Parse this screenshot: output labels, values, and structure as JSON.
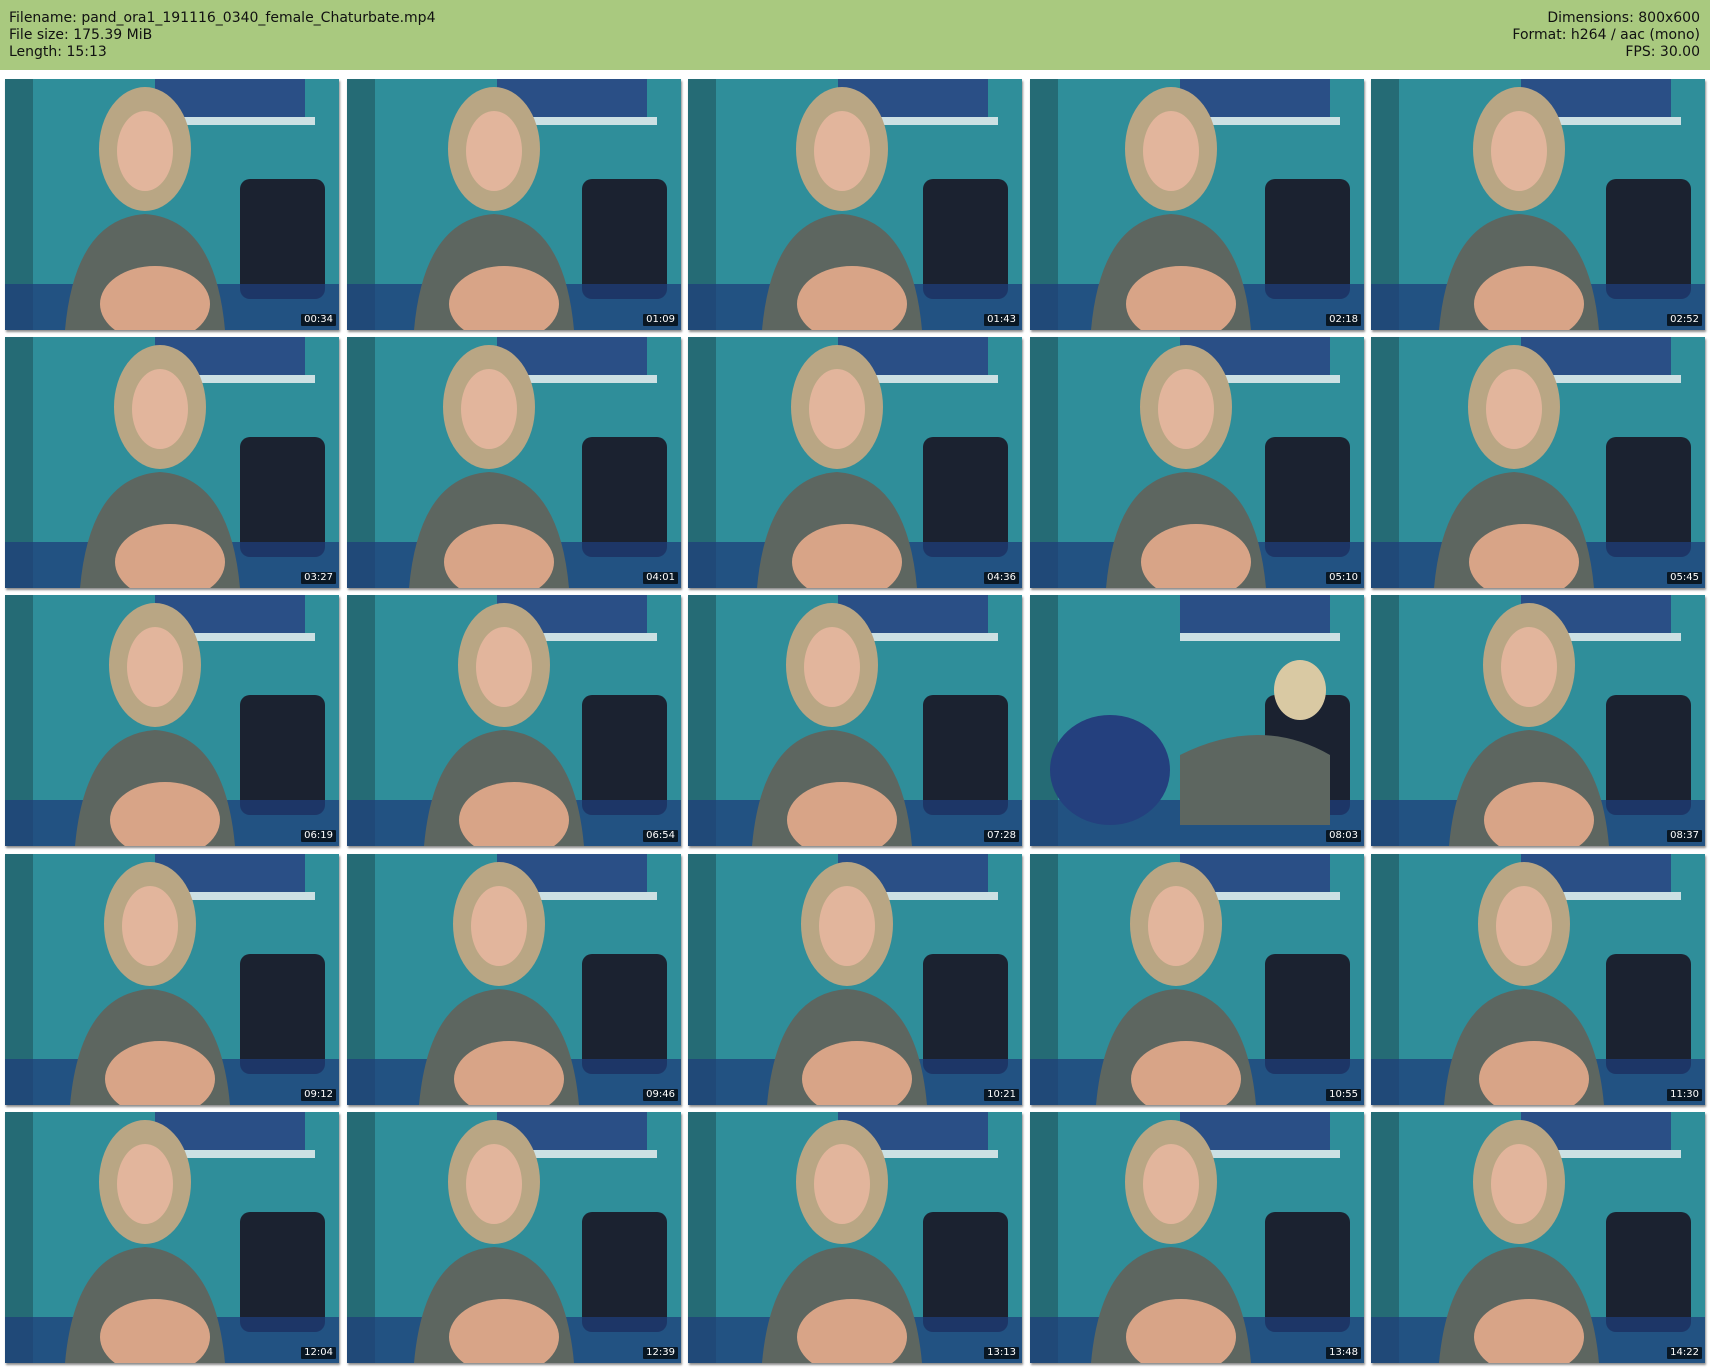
{
  "header": {
    "left": [
      {
        "label": "Filename:",
        "value": "pand_ora1_191116_0340_female_Chaturbate.mp4"
      },
      {
        "label": "File size:",
        "value": "175.39 MiB"
      },
      {
        "label": "Length:",
        "value": "15:13"
      }
    ],
    "right": [
      {
        "label": "Dimensions:",
        "value": "800x600"
      },
      {
        "label": "Format:",
        "value": "h264 / aac (mono)"
      },
      {
        "label": "FPS:",
        "value": "30.00"
      }
    ]
  },
  "thumbnails": [
    {
      "time": "00:34"
    },
    {
      "time": "01:09"
    },
    {
      "time": "01:43"
    },
    {
      "time": "02:18"
    },
    {
      "time": "02:52"
    },
    {
      "time": "03:27"
    },
    {
      "time": "04:01"
    },
    {
      "time": "04:36"
    },
    {
      "time": "05:10"
    },
    {
      "time": "05:45"
    },
    {
      "time": "06:19"
    },
    {
      "time": "06:54"
    },
    {
      "time": "07:28"
    },
    {
      "time": "08:03"
    },
    {
      "time": "08:37"
    },
    {
      "time": "09:12"
    },
    {
      "time": "09:46"
    },
    {
      "time": "10:21"
    },
    {
      "time": "10:55"
    },
    {
      "time": "11:30"
    },
    {
      "time": "12:04"
    },
    {
      "time": "12:39"
    },
    {
      "time": "13:13"
    },
    {
      "time": "13:48"
    },
    {
      "time": "14:22"
    }
  ],
  "colors": {
    "header_bg": "#a9c97f",
    "wall": "#2f8e9a",
    "chair": "#1b2230",
    "poster": "#2a4f86"
  }
}
